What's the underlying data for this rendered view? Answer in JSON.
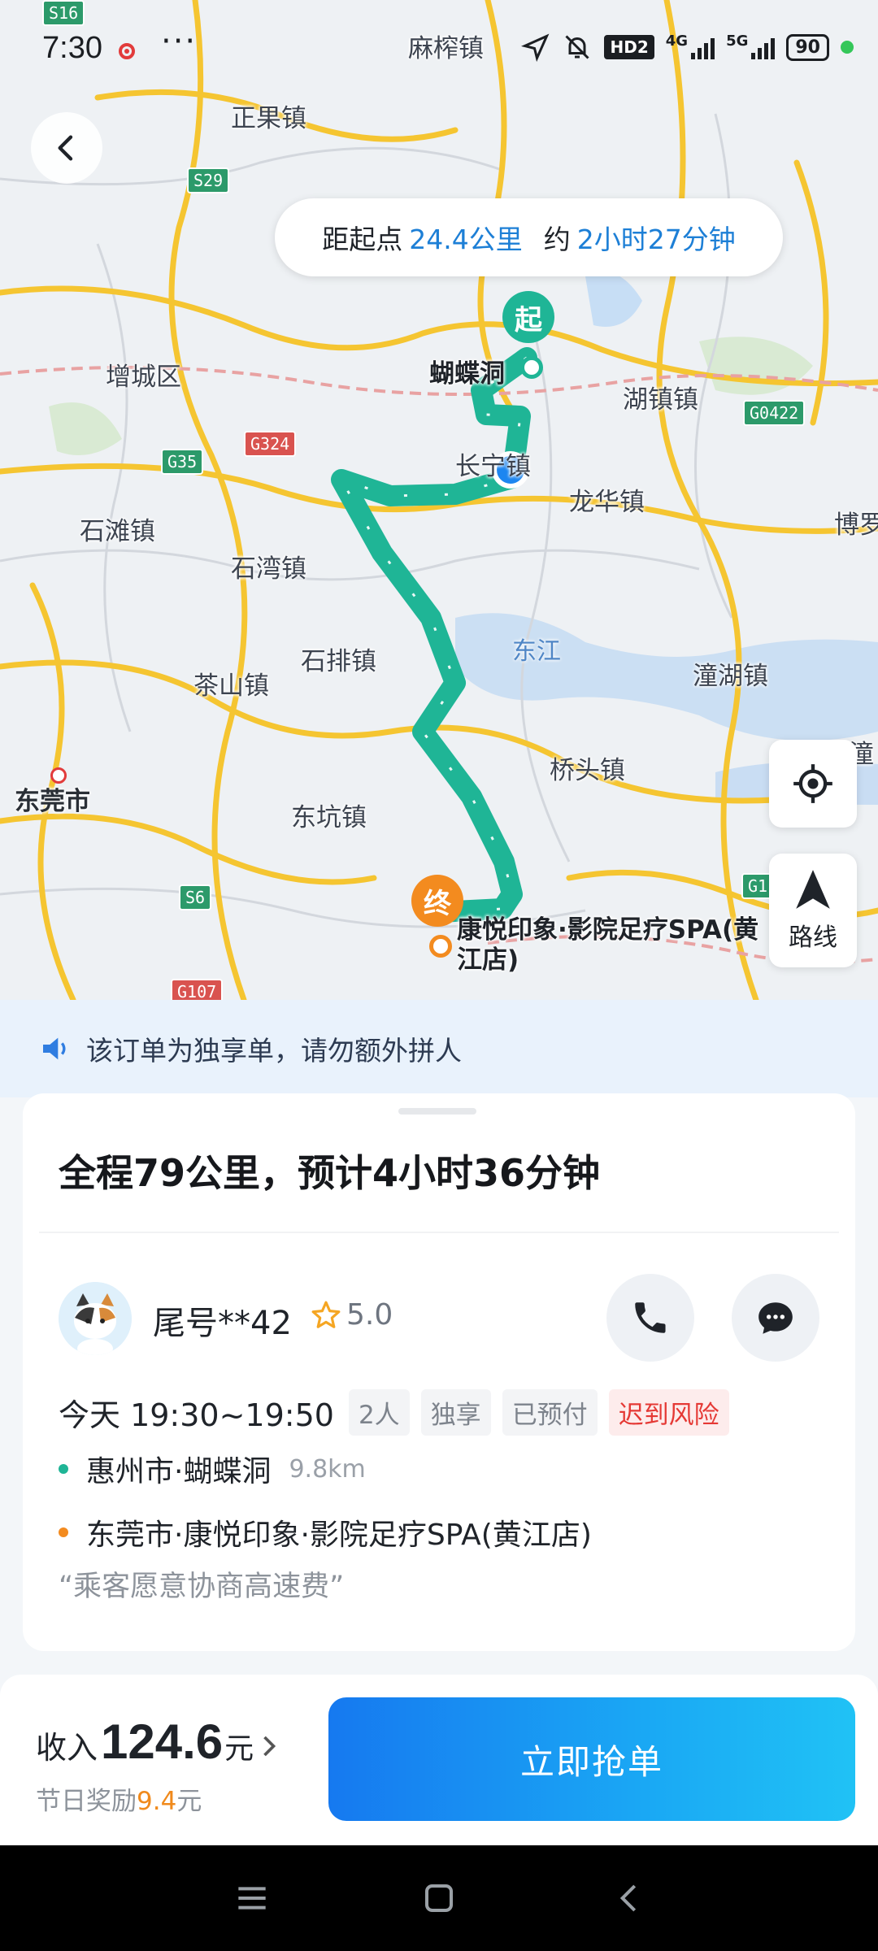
{
  "status_bar": {
    "time": "7:30",
    "dots": "···",
    "hd": "HD2",
    "net1": "4G",
    "net2": "5G",
    "battery": "90"
  },
  "map": {
    "places": {
      "zhengguo": "正果镇",
      "mazha": "麻榨镇",
      "zengcheng": "增城区",
      "hudu": "湖镇镇",
      "changning": "长宁镇",
      "longhua": "龙华镇",
      "shitan": "石滩镇",
      "shiwan": "石湾镇",
      "bo": "博罗",
      "shipai": "石排镇",
      "chashan": "茶山镇",
      "tonghu": "潼湖镇",
      "dongguan": "东莞市",
      "qiaotou": "桥头镇",
      "tong": "潼",
      "dongkeng": "东坑镇",
      "hudie": "蝴蝶洞",
      "end_label": "康悦印象·影院足疗SPA(黄江店)"
    },
    "river": "东江",
    "shields": {
      "s16": "S16",
      "s29": "S29",
      "g35": "G35",
      "g324": "G324",
      "g0422": "G0422",
      "s6": "S6",
      "g1": "G1",
      "g107": "G107"
    },
    "start_marker": "起",
    "end_marker": "终",
    "route_label": "路线"
  },
  "distance": {
    "prefix": "距起点",
    "km": "24.4公里",
    "mid": "约",
    "duration": "2小时27分钟"
  },
  "notice": "该订单为独享单，请勿额外拼人",
  "order": {
    "summary": "全程79公里，预计4小时36分钟",
    "passenger": {
      "name": "尾号**42",
      "rating": "5.0"
    },
    "time": "今天 19:30~19:50",
    "tags": [
      "2人",
      "独享",
      "已预付",
      "迟到风险"
    ],
    "pickup": {
      "address": "惠州市·蝴蝶洞",
      "distance": "9.8km"
    },
    "dropoff": {
      "address": "东莞市·康悦印象·影院足疗SPA(黄江店)"
    },
    "remark": "“乘客愿意协商高速费”"
  },
  "bottom": {
    "income_label": "收入",
    "income_value": "124.6",
    "income_unit": "元",
    "bonus_label": "节日奖励",
    "bonus_value": "9.4",
    "bonus_unit": "元",
    "grab_button": "立即抢单"
  },
  "colors": {
    "route": "#1fb596",
    "accent": "#1d7fd6",
    "risk": "#e53935",
    "end": "#f38b1f"
  }
}
